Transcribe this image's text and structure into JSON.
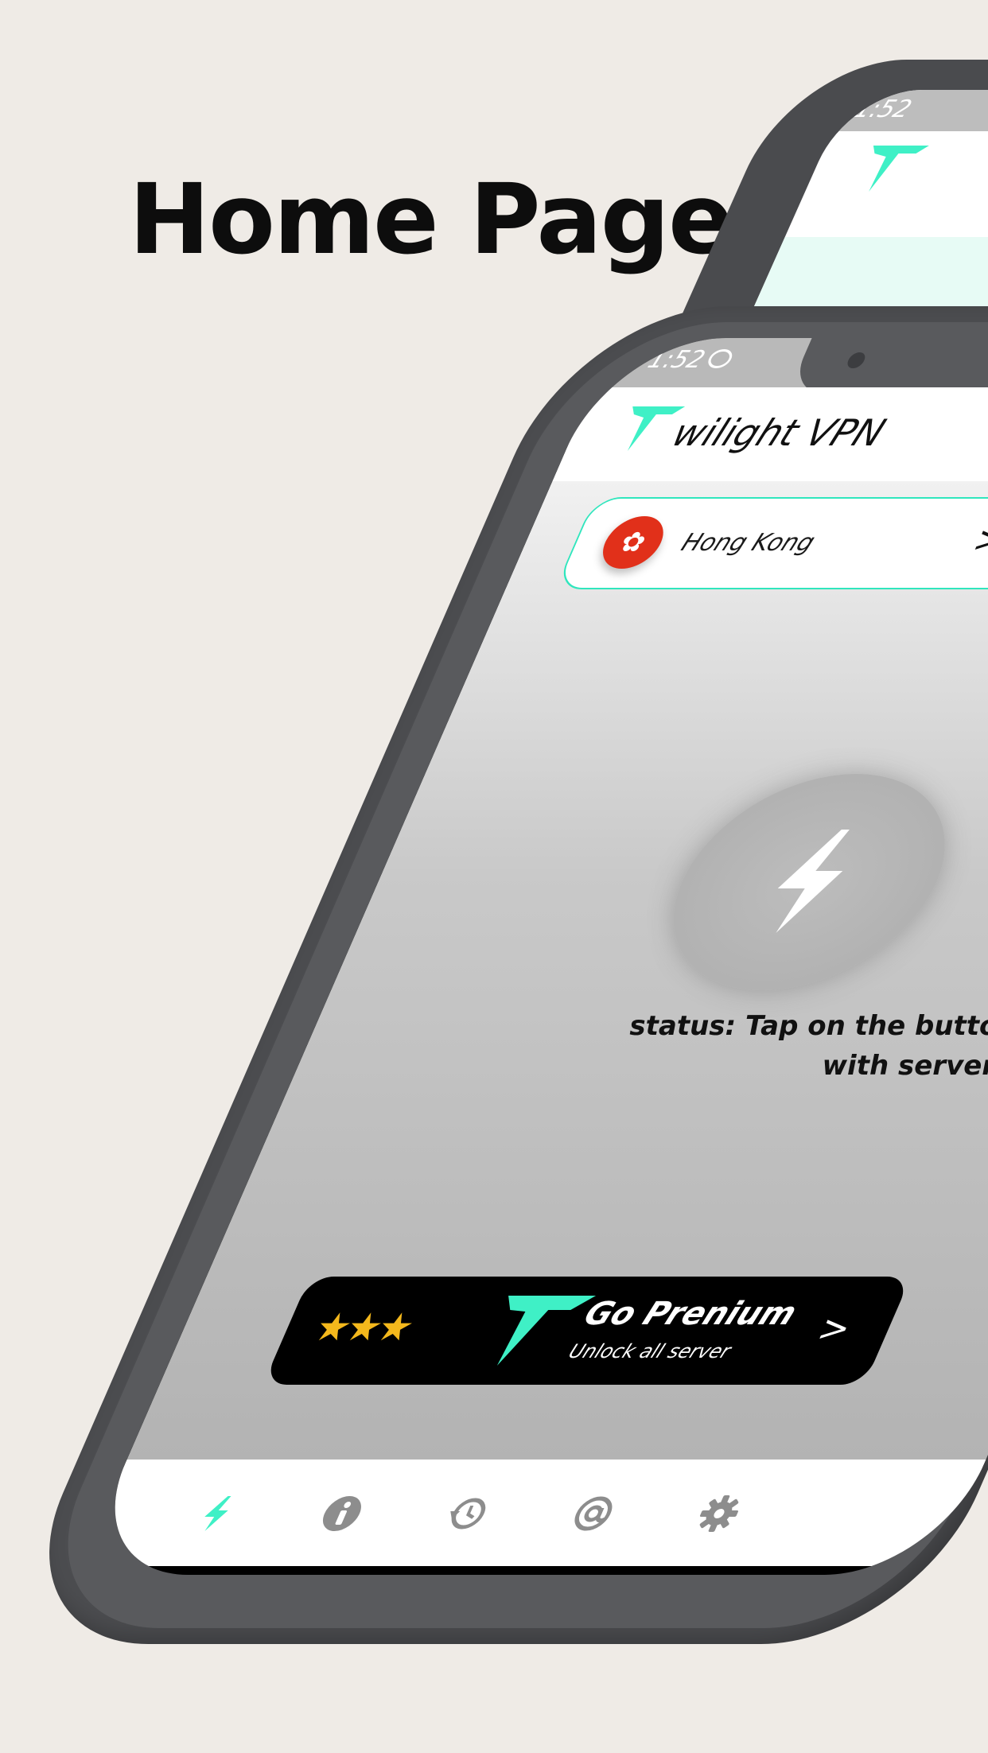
{
  "headline": "Home Page",
  "status_bar": {
    "time": "1:52"
  },
  "app": {
    "title": "wilight VPN"
  },
  "server": {
    "name": "Hong Kong",
    "flag_icon": "hong-kong-flag-icon"
  },
  "connect_button": {
    "icon": "lightning-bolt-icon"
  },
  "status_text": "status: Tap on the button to connect with server",
  "premium": {
    "title": "Go Prenium",
    "subtitle": "Unlock all server",
    "stars": "★★★",
    "star_color": "#f4b81c"
  },
  "bottom_nav": [
    {
      "icon": "lightning-bolt-icon",
      "active": true
    },
    {
      "icon": "info-icon"
    },
    {
      "icon": "history-icon"
    },
    {
      "icon": "at-sign-icon"
    },
    {
      "icon": "gear-icon"
    }
  ],
  "colors": {
    "accent": "#2fe6bd",
    "background": "#efebe6",
    "phone_body": "#4c4d50"
  }
}
